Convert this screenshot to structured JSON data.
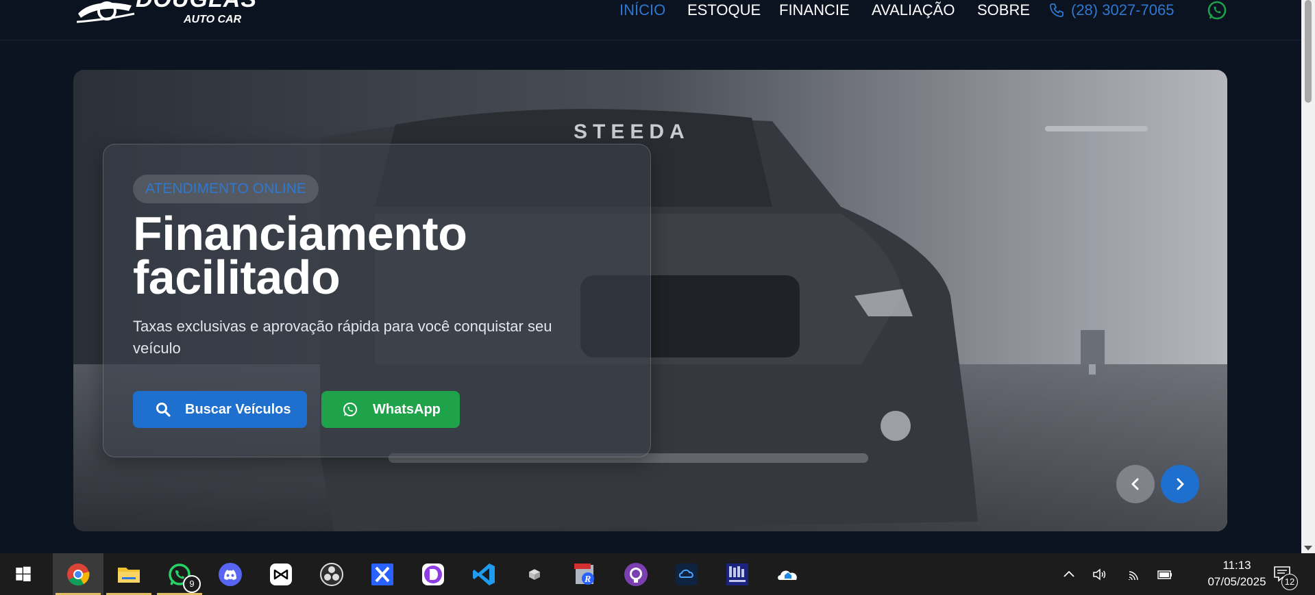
{
  "brand": {
    "name": "DOUGLAS",
    "sub": "AUTO CAR"
  },
  "nav": {
    "items": [
      {
        "label": "INÍCIO",
        "active": true
      },
      {
        "label": "ESTOQUE",
        "active": false
      },
      {
        "label": "FINANCIE",
        "active": false
      },
      {
        "label": "AVALIAÇÃO",
        "active": false
      },
      {
        "label": "SOBRE",
        "active": false
      }
    ],
    "phone": "(28) 3027-7065",
    "whatsapp_icon": "whatsapp-icon"
  },
  "hero": {
    "badge": "ATENDIMENTO ONLINE",
    "title_line1": "Financiamento",
    "title_line2": "facilitado",
    "description": "Taxas exclusivas e aprovação rápida para você conquistar seu veículo",
    "windshield_text": "STEEDA",
    "buttons": {
      "search": "Buscar Veículos",
      "whatsapp": "WhatsApp"
    }
  },
  "colors": {
    "accent": "#1f6fcf",
    "whatsapp": "#1ea24a",
    "header_bg": "#0b1220",
    "page_bg": "#0d1421"
  },
  "taskbar": {
    "apps": [
      {
        "name": "chrome-icon",
        "active": true
      },
      {
        "name": "file-explorer-icon"
      },
      {
        "name": "whatsapp-icon",
        "badge": "9"
      },
      {
        "name": "discord-icon"
      },
      {
        "name": "capcut-icon"
      },
      {
        "name": "obs-icon"
      },
      {
        "name": "app-x-icon"
      },
      {
        "name": "app-d-icon"
      },
      {
        "name": "vscode-icon"
      },
      {
        "name": "box-icon"
      },
      {
        "name": "app-r-icon"
      },
      {
        "name": "github-icon"
      },
      {
        "name": "cloud-app-icon"
      },
      {
        "name": "httrack-icon"
      },
      {
        "name": "onedrive-house-icon"
      }
    ],
    "time": "11:13",
    "date": "07/05/2025",
    "notifications": "12"
  }
}
